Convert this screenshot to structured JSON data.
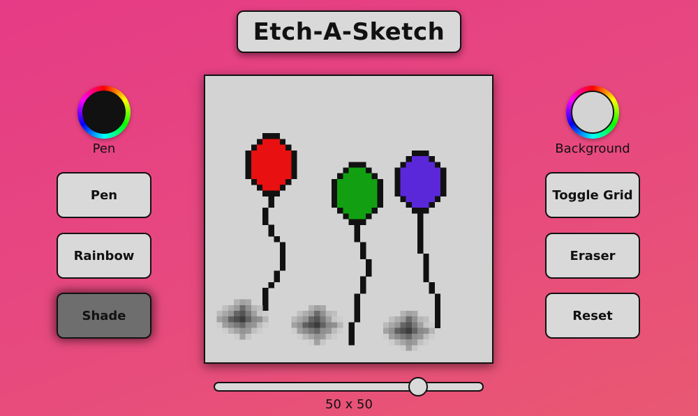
{
  "title": "Etch-A-Sketch",
  "pen_picker": {
    "label": "Pen",
    "color": "#111111"
  },
  "background_picker": {
    "label": "Background",
    "color": "#d3d3d3"
  },
  "left_buttons": [
    {
      "label": "Pen",
      "active": false
    },
    {
      "label": "Rainbow",
      "active": false
    },
    {
      "label": "Shade",
      "active": true
    }
  ],
  "right_buttons": [
    {
      "label": "Toggle Grid"
    },
    {
      "label": "Eraser"
    },
    {
      "label": "Reset"
    }
  ],
  "grid": {
    "size": 50,
    "background": "#d3d3d3",
    "balloon_colors": {
      "red": "#e81010",
      "green": "#12a012",
      "purple": "#5a28d8"
    }
  },
  "slider": {
    "value": 50,
    "min": 1,
    "max": 64,
    "label": "50 x 50"
  }
}
